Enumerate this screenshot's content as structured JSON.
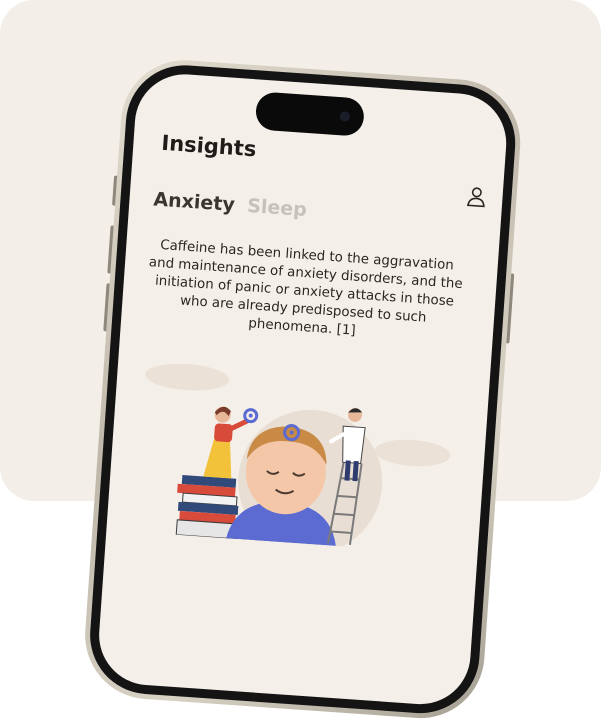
{
  "header": {
    "title": "Insights"
  },
  "tabs": [
    {
      "label": "Anxiety",
      "active": true
    },
    {
      "label": "Sleep",
      "active": false
    }
  ],
  "content": {
    "paragraph": "Caffeine has been linked to the aggravation and maintenance of anxiety disorders, and the initiation of panic or anxiety attacks in those who are already predisposed to such phenomena. [1]"
  },
  "icons": {
    "profile": "person-icon"
  },
  "colors": {
    "background": "#f3eee8",
    "screen": "#f5efe9",
    "title": "#1e1b18",
    "tab_active": "#3a3530",
    "tab_inactive": "#c6c1bb"
  }
}
